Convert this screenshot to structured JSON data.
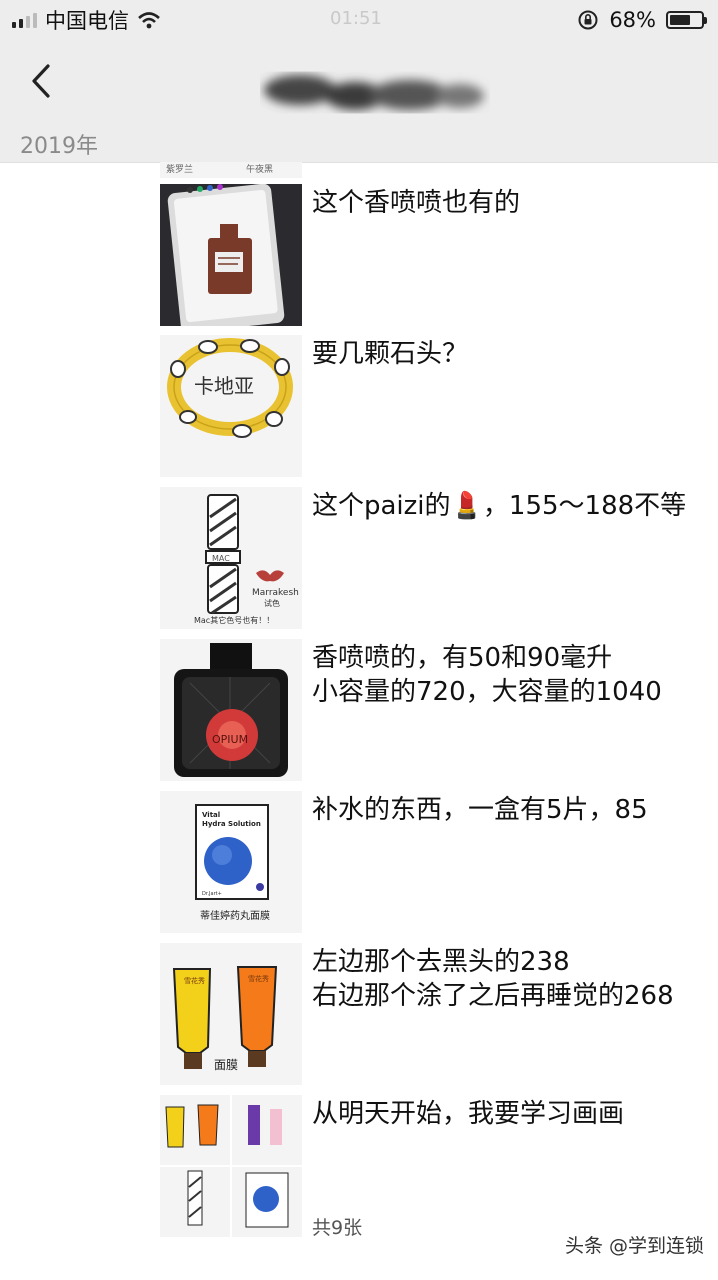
{
  "status_bar": {
    "carrier": "中国电信",
    "time": "01:51",
    "battery_percent": "68%",
    "battery_level": 0.68
  },
  "header": {
    "back_icon": "chevron-left-icon",
    "year": "2019年"
  },
  "feed": {
    "top_strip": [
      "紫罗兰",
      "午夜黑"
    ],
    "items": [
      {
        "text": "这个香喷喷也有的",
        "thumb": "perfume-bottle-sketch"
      },
      {
        "text": "要几颗石头？",
        "thumb": "bracelet-sketch",
        "thumb_text": "卡地亚"
      },
      {
        "text": "这个paizi的💄，155～188不等",
        "thumb": "lipstick-sketch",
        "thumb_text": [
          "Marrakesh",
          "试色",
          "Mac其它色号也有！！",
          "MAC"
        ]
      },
      {
        "text": "香喷喷的，有50和90毫升\n小容量的720，大容量的1040",
        "thumb": "black-opium-sketch",
        "thumb_text": "OPIUM"
      },
      {
        "text": "补水的东西，一盒有5片，85",
        "thumb": "face-mask-sketch",
        "thumb_text": [
          "Vital",
          "Hydra Solution",
          "Dr.Jart+",
          "蒂佳婷药丸面膜"
        ]
      },
      {
        "text": "左边那个去黑头的238\n右边那个涂了之后再睡觉的268",
        "thumb": "sulwhasoo-sketch",
        "thumb_text": [
          "面膜",
          "雪花秀"
        ]
      },
      {
        "text": "从明天开始，我要学习画画",
        "thumb": "collage-sketch",
        "count": "共9张"
      }
    ]
  },
  "watermark": "头条 @学到连锁"
}
